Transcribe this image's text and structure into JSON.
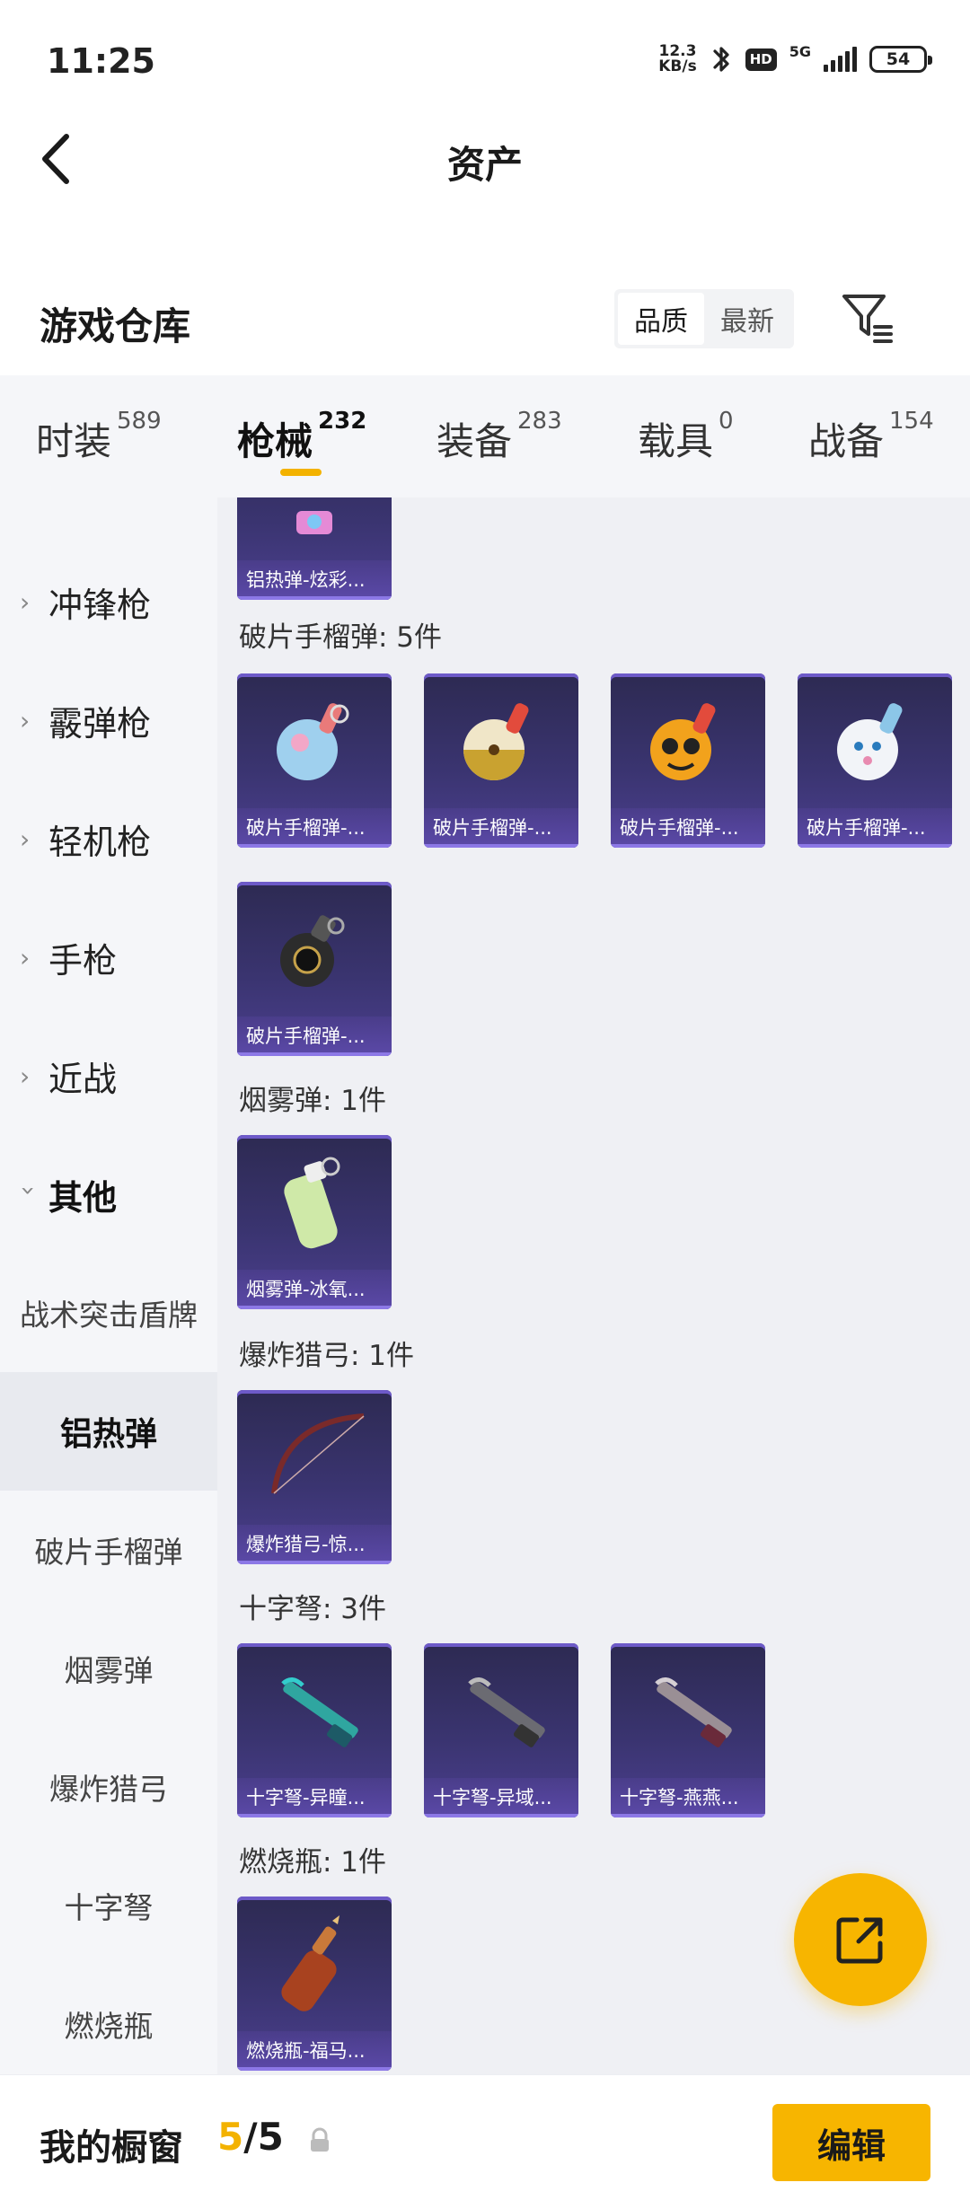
{
  "status_bar": {
    "time": "11:25",
    "net_speed_value": "12.3",
    "net_speed_unit": "KB/s",
    "hd": "HD",
    "network": "5G",
    "battery": "54"
  },
  "nav": {
    "title": "资产"
  },
  "warehouse": {
    "title": "游戏仓库",
    "sort_options": [
      "品质",
      "最新"
    ],
    "sort_selected": "品质"
  },
  "tabs": [
    {
      "label": "时装",
      "count": "589"
    },
    {
      "label": "枪械",
      "count": "232"
    },
    {
      "label": "装备",
      "count": "283"
    },
    {
      "label": "载具",
      "count": "0"
    },
    {
      "label": "战备",
      "count": "154"
    }
  ],
  "active_tab": "枪械",
  "side_menu": {
    "categories": [
      "冲锋枪",
      "霰弹枪",
      "轻机枪",
      "手枪",
      "近战",
      "其他"
    ],
    "open_category": "其他",
    "subitems": [
      "战术突击盾牌",
      "铝热弹",
      "破片手榴弹",
      "烟雾弹",
      "爆炸猎弓",
      "十字弩",
      "燃烧瓶"
    ],
    "selected_subitem": "铝热弹"
  },
  "content": {
    "partial_card": {
      "name": "铝热弹-炫彩..."
    },
    "sections": [
      {
        "header": "破片手榴弹: 5件",
        "items": [
          "破片手榴弹-...",
          "破片手榴弹-...",
          "破片手榴弹-...",
          "破片手榴弹-...",
          "破片手榴弹-..."
        ]
      },
      {
        "header": "烟雾弹: 1件",
        "items": [
          "烟雾弹-冰氧..."
        ]
      },
      {
        "header": "爆炸猎弓: 1件",
        "items": [
          "爆炸猎弓-惊..."
        ]
      },
      {
        "header": "十字弩: 3件",
        "items": [
          "十字弩-异瞳...",
          "十字弩-异域...",
          "十字弩-燕燕..."
        ]
      },
      {
        "header": "燃烧瓶: 1件",
        "items": [
          "燃烧瓶-福马..."
        ]
      }
    ]
  },
  "bottom_bar": {
    "title": "我的橱窗",
    "current": "5",
    "separator": "/",
    "total": "5",
    "edit_label": "编辑"
  },
  "colors": {
    "accent": "#f7b500",
    "card_bg": "#3a3470",
    "panel_bg": "#f5f6f9"
  }
}
